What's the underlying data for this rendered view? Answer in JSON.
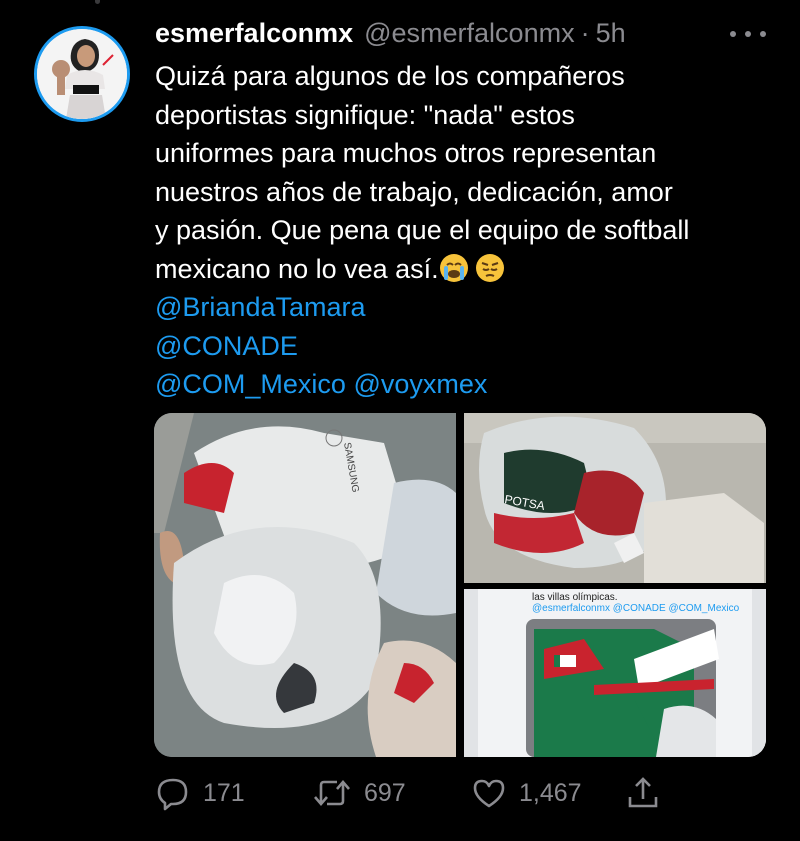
{
  "tweet": {
    "display_name": "esmerfalconmx",
    "handle": "@esmerfalconmx",
    "separator": "·",
    "time": "5h",
    "text_lines": [
      "Quizá para algunos de los compañeros",
      "deportistas signifique: \"nada\" estos",
      "uniformes para muchos otros representan",
      "nuestros años de trabajo, dedicación, amor",
      "y pasión. Que pena que el equipo de softball",
      "mexicano no lo vea así."
    ],
    "emojis": [
      "loudly-crying-face",
      "pensive-face"
    ],
    "mentions": [
      "@BriandaTamara",
      "@CONADE",
      "@COM_Mexico",
      "@voyxmex"
    ],
    "mention_color": "#1d9bf0",
    "media": {
      "photo_count": 3,
      "screenshot_text_line1": "las villas olímpicas.",
      "screenshot_text_line2": "@esmerfalconmx @CONADE @COM_Mexico"
    },
    "actions": {
      "reply_count": "171",
      "retweet_count": "697",
      "like_count": "1,467"
    },
    "icons": [
      "more-icon",
      "reply-icon",
      "retweet-icon",
      "like-icon",
      "share-icon"
    ]
  }
}
